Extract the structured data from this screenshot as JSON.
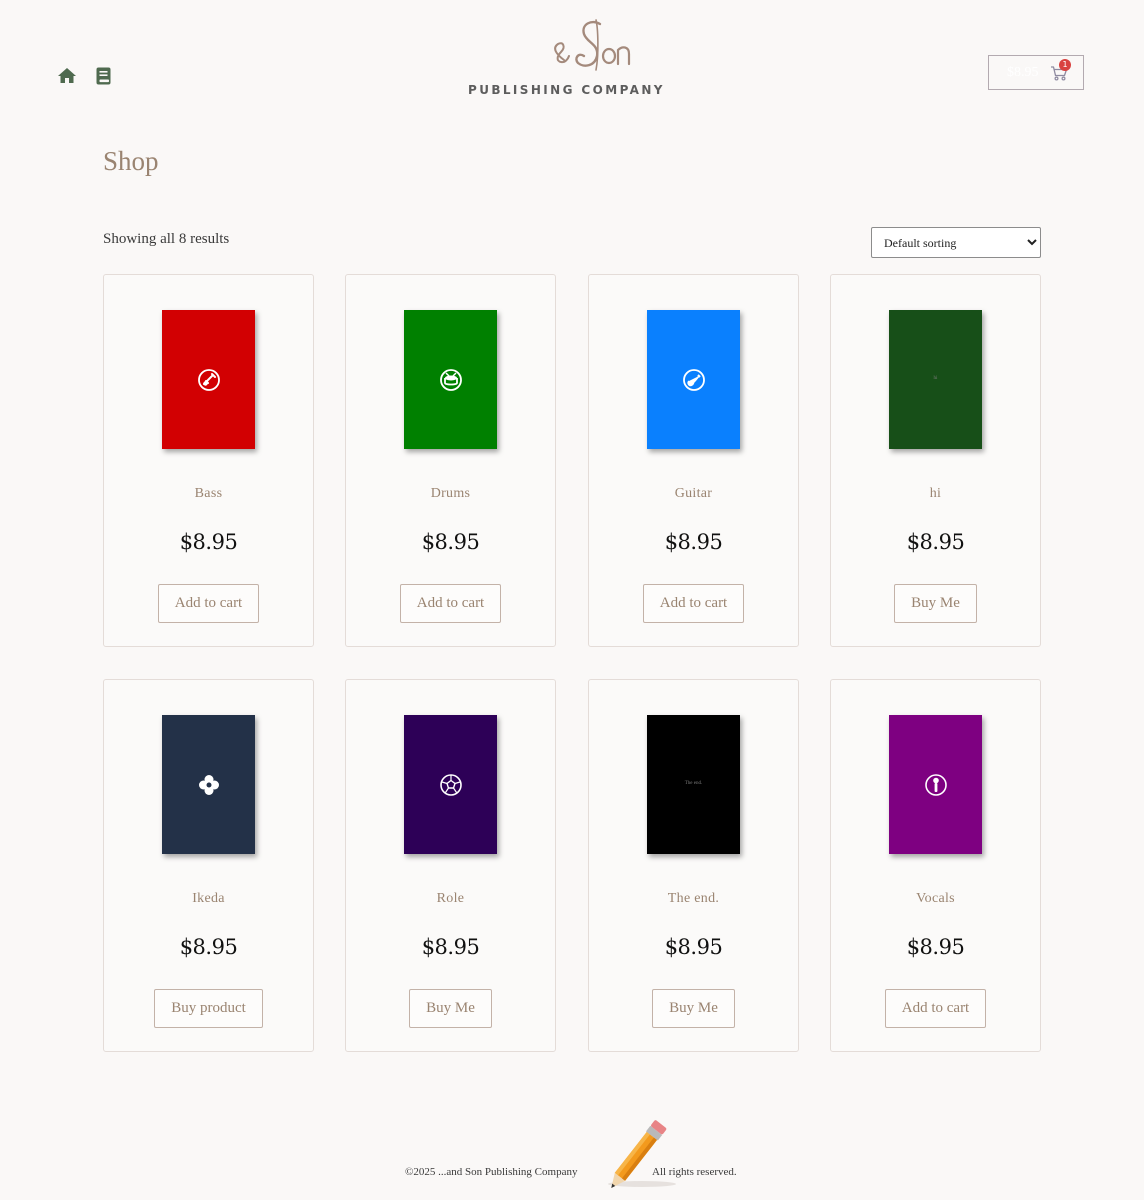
{
  "header": {
    "brand_script": "& Son",
    "brand_text": "PUBLISHING COMPANY",
    "cart_total": "$8.95",
    "cart_count": "1"
  },
  "page": {
    "title": "Shop",
    "result_count": "Showing all 8 results",
    "sorting": {
      "selected": "Default sorting",
      "options": [
        "Default sorting"
      ]
    }
  },
  "products": [
    {
      "name": "Bass",
      "price": "$8.95",
      "button": "Add to cart",
      "cover_color": "#d20002",
      "icon": "bass-guitar-icon"
    },
    {
      "name": "Drums",
      "price": "$8.95",
      "button": "Add to cart",
      "cover_color": "#008000",
      "icon": "drum-icon"
    },
    {
      "name": "Guitar",
      "price": "$8.95",
      "button": "Add to cart",
      "cover_color": "#0a80fe",
      "icon": "guitar-icon"
    },
    {
      "name": "hi",
      "price": "$8.95",
      "button": "Buy Me",
      "cover_color": "#174f18",
      "icon": "",
      "cover_text": "hi"
    },
    {
      "name": "Ikeda",
      "price": "$8.95",
      "button": "Buy product",
      "cover_color": "#233148",
      "icon": "flower-icon"
    },
    {
      "name": "Role",
      "price": "$8.95",
      "button": "Buy Me",
      "cover_color": "#2d0057",
      "icon": "soccer-ball-icon"
    },
    {
      "name": "The end.",
      "price": "$8.95",
      "button": "Buy Me",
      "cover_color": "#000000",
      "icon": "",
      "cover_text": "The end."
    },
    {
      "name": "Vocals",
      "price": "$8.95",
      "button": "Add to cart",
      "cover_color": "#7e0081",
      "icon": "microphone-icon"
    }
  ],
  "footer": {
    "copyright": "©2025 ...and Son Publishing Company",
    "rights": "All rights reserved."
  },
  "colors": {
    "accent": "#9a8471",
    "nav_icon": "#4f6a4f",
    "badge": "#d9413f",
    "background": "#faf8f7"
  }
}
